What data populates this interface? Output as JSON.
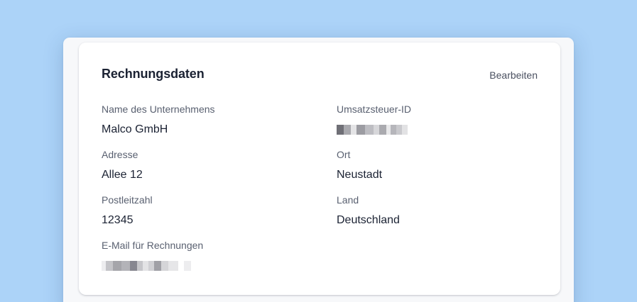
{
  "card": {
    "title": "Rechnungsdaten",
    "edit_label": "Bearbeiten"
  },
  "fields": {
    "company_name": {
      "label": "Name des Unternehmens",
      "value": "Malco GmbH"
    },
    "vat_id": {
      "label": "Umsatzsteuer-ID",
      "value_redacted": true
    },
    "address": {
      "label": "Adresse",
      "value": "Allee 12"
    },
    "city": {
      "label": "Ort",
      "value": "Neustadt"
    },
    "postal_code": {
      "label": "Postleitzahl",
      "value": "12345"
    },
    "country": {
      "label": "Land",
      "value": "Deutschland"
    },
    "invoice_email": {
      "label": "E-Mail für Rechnungen",
      "value_redacted": true
    }
  },
  "colors": {
    "background": "#acd3f8",
    "card": "#ffffff",
    "text_primary": "#1b2233",
    "text_secondary": "#596070"
  }
}
